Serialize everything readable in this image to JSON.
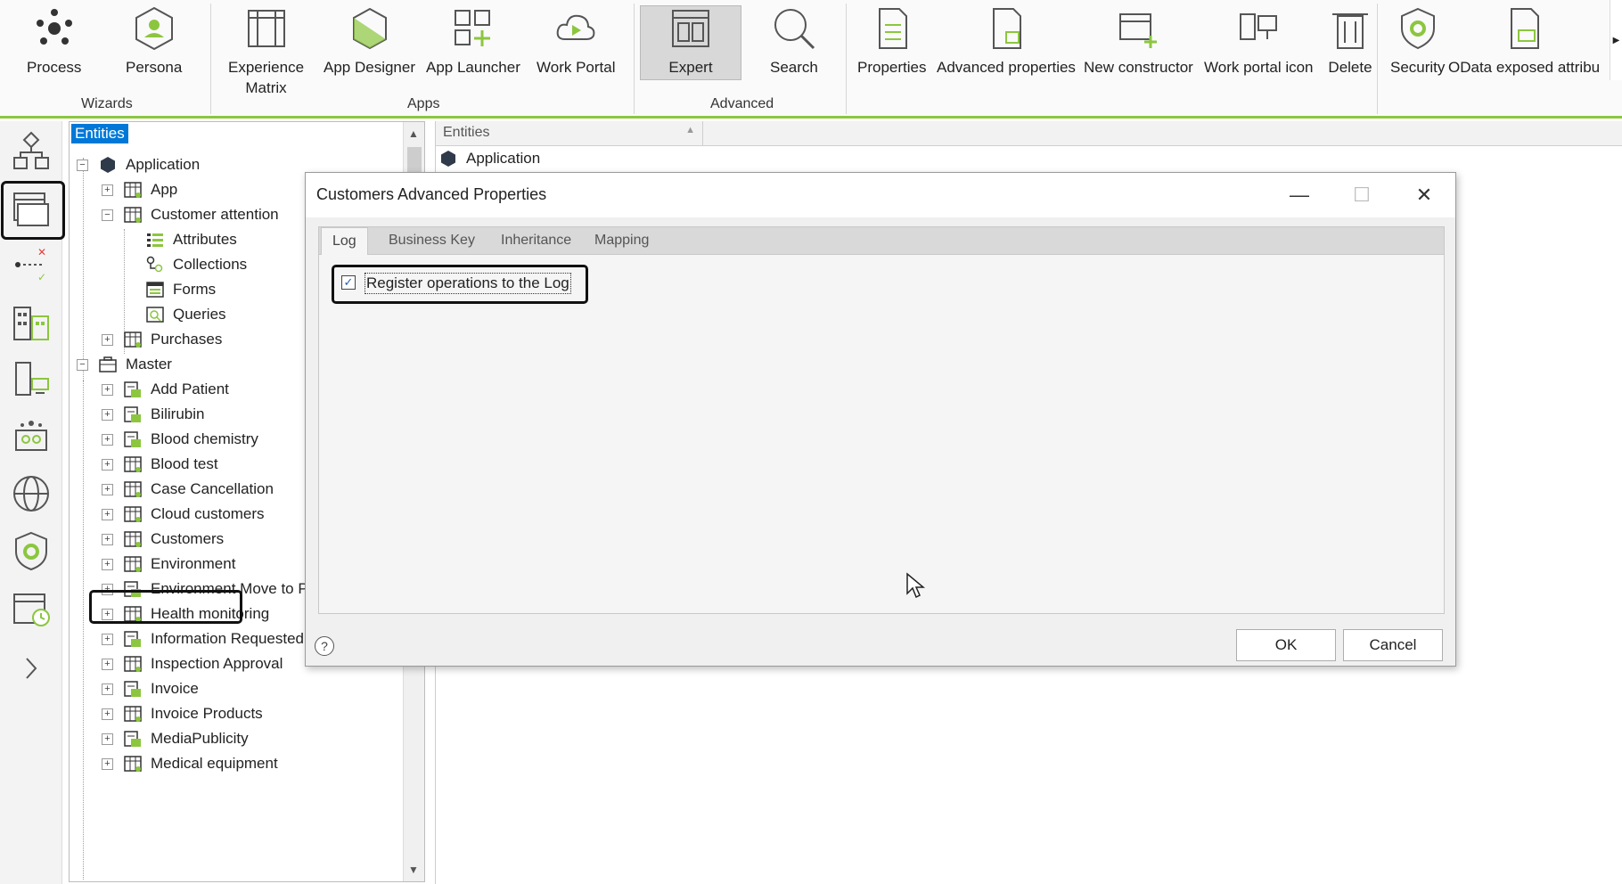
{
  "ribbon": {
    "buttons": {
      "process": "Process",
      "persona": "Persona",
      "experience_matrix_1": "Experience",
      "experience_matrix_2": "Matrix",
      "app_designer": "App Designer",
      "app_launcher": "App Launcher",
      "work_portal": "Work Portal",
      "expert": "Expert",
      "search": "Search",
      "properties": "Properties",
      "advanced_properties": "Advanced properties",
      "new_constructor": "New constructor",
      "work_portal_icon": "Work portal icon",
      "delete": "Delete",
      "security": "Security",
      "odata": "OData exposed attribu"
    },
    "groups": {
      "wizards": "Wizards",
      "apps": "Apps",
      "advanced": "Advanced"
    },
    "accent_color": "#8cc63f"
  },
  "tree": {
    "header": "Entities",
    "items": [
      {
        "label": "Application"
      },
      {
        "label": "App"
      },
      {
        "label": "Customer attention"
      },
      {
        "label": "Attributes"
      },
      {
        "label": "Collections"
      },
      {
        "label": "Forms"
      },
      {
        "label": "Queries"
      },
      {
        "label": "Purchases"
      },
      {
        "label": "Master"
      },
      {
        "label": "Add Patient"
      },
      {
        "label": "Bilirubin"
      },
      {
        "label": "Blood chemistry"
      },
      {
        "label": "Blood test"
      },
      {
        "label": "Case Cancellation"
      },
      {
        "label": "Cloud customers"
      },
      {
        "label": "Customers"
      },
      {
        "label": "Environment"
      },
      {
        "label": "Environment Move to Pass"
      },
      {
        "label": "Health monitoring"
      },
      {
        "label": "Information Requested"
      },
      {
        "label": "Inspection Approval"
      },
      {
        "label": "Invoice"
      },
      {
        "label": "Invoice Products"
      },
      {
        "label": "MediaPublicity"
      },
      {
        "label": "Medical equipment"
      }
    ],
    "selection_color": "#0078d7"
  },
  "entities_panel": {
    "column_header": "Entities",
    "row_label": "Application"
  },
  "dialog": {
    "title": "Customers Advanced Properties",
    "tabs": [
      "Log",
      "Business Key",
      "Inheritance",
      "Mapping"
    ],
    "active_tab": "Log",
    "log_checkbox_label": "Register operations to the Log",
    "log_checkbox_checked": true,
    "ok_label": "OK",
    "cancel_label": "Cancel",
    "help_glyph": "?",
    "minimize_glyph": "—",
    "maximize_glyph": "☐",
    "close_glyph": "✕"
  }
}
